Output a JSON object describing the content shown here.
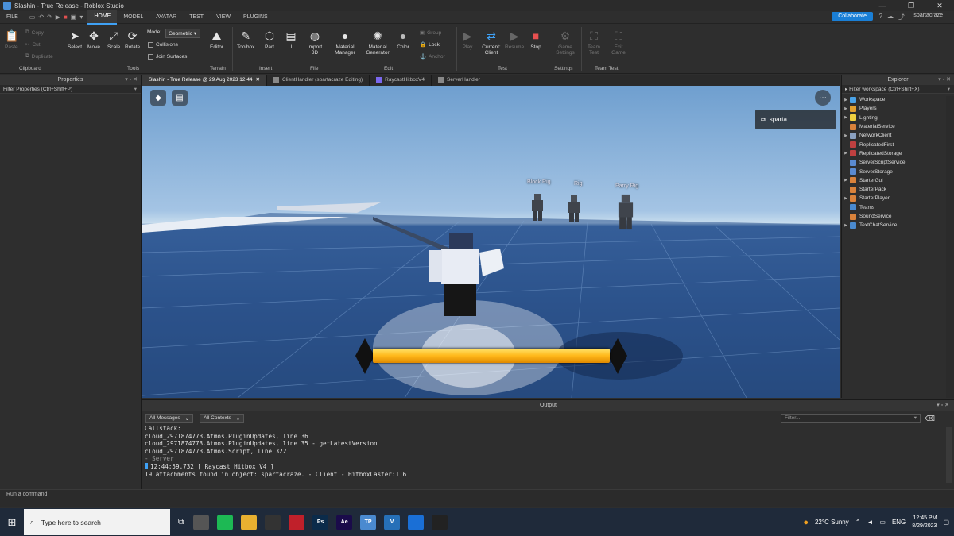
{
  "window": {
    "title": "Slashin - True Release - Roblox Studio",
    "controls": [
      "—",
      "❐",
      "✕"
    ]
  },
  "menu": {
    "items": [
      "FILE",
      "HOME",
      "MODEL",
      "AVATAR",
      "TEST",
      "VIEW",
      "PLUGINS"
    ],
    "active": "HOME",
    "collaborate": "Collaborate",
    "username": "spartacraze"
  },
  "ribbon": {
    "paste": "Paste",
    "copy": "Copy",
    "cut": "Cut",
    "duplicate": "Duplicate",
    "clipboard": "Clipboard",
    "select": "Select",
    "move": "Move",
    "scale": "Scale",
    "rotate": "Rotate",
    "mode_label": "Mode:",
    "mode_value": "Geometric",
    "collisions": "Collisions",
    "join_surfaces": "Join Surfaces",
    "tools": "Tools",
    "editor": "Editor",
    "terrain": "Terrain",
    "toolbox": "Toolbox",
    "part": "Part",
    "ui": "UI",
    "insert": "Insert",
    "import_3d": "Import 3D",
    "file": "File",
    "material_manager": "Material Manager",
    "material_generator": "Material Generator",
    "color": "Color",
    "group": "Group",
    "lock": "Lock",
    "anchor": "Anchor",
    "edit": "Edit",
    "play": "Play",
    "current_client": "Current: Client",
    "resume": "Resume",
    "stop": "Stop",
    "test": "Test",
    "game_settings": "Game Settings",
    "settings": "Settings",
    "team_test": "Team Test",
    "exit_game": "Exit Game",
    "team_test_group": "Team Test"
  },
  "properties": {
    "title": "Properties",
    "filter": "Filter Properties (Ctrl+Shift+P)"
  },
  "tabs": [
    {
      "label": "Slashin - True Release @ 29 Aug 2023 12:44",
      "active": true
    },
    {
      "label": "ClientHandler (spartacraze Editing)",
      "active": false
    },
    {
      "label": "RaycastHitboxV4",
      "active": false
    },
    {
      "label": "ServerHandler",
      "active": false
    }
  ],
  "viewport": {
    "player_name": "sparta",
    "rig_labels": [
      "Block Rig",
      "Rig",
      "Parry Rig"
    ],
    "bar_fill_fraction": 1.0
  },
  "explorer": {
    "title": "Explorer",
    "filter": "Filter workspace (Ctrl+Shift+X)",
    "items": [
      {
        "label": "Workspace",
        "expandable": true,
        "color": "#4aa3e8"
      },
      {
        "label": "Players",
        "expandable": true,
        "color": "#e0a030"
      },
      {
        "label": "Lighting",
        "expandable": true,
        "color": "#f0d040"
      },
      {
        "label": "MaterialService",
        "expandable": false,
        "color": "#d9823b"
      },
      {
        "label": "NetworkClient",
        "expandable": true,
        "color": "#8aa0c0"
      },
      {
        "label": "ReplicatedFirst",
        "expandable": false,
        "color": "#c04040"
      },
      {
        "label": "ReplicatedStorage",
        "expandable": true,
        "color": "#c04040"
      },
      {
        "label": "ServerScriptService",
        "expandable": false,
        "color": "#5a8ad0"
      },
      {
        "label": "ServerStorage",
        "expandable": false,
        "color": "#5a8ad0"
      },
      {
        "label": "StarterGui",
        "expandable": true,
        "color": "#d9823b"
      },
      {
        "label": "StarterPack",
        "expandable": false,
        "color": "#d9823b"
      },
      {
        "label": "StarterPlayer",
        "expandable": true,
        "color": "#d9823b"
      },
      {
        "label": "Teams",
        "expandable": false,
        "color": "#4a8ad0"
      },
      {
        "label": "SoundService",
        "expandable": false,
        "color": "#d9823b"
      },
      {
        "label": "TextChatService",
        "expandable": true,
        "color": "#4a8ad0"
      }
    ]
  },
  "output": {
    "title": "Output",
    "messages_filter": "All Messages",
    "contexts_filter": "All Contexts",
    "filter_placeholder": "Filter...",
    "lines": [
      "Callstack:",
      "cloud_2971874773.Atmos.PluginUpdates, line 36",
      "cloud_2971874773.Atmos.PluginUpdates, line 35 - getLatestVersion",
      "cloud_2971874773.Atmos.Script, line 322"
    ],
    "server_line": " -  Server",
    "timestamp_line": "12:44:59.732  [ Raycast Hitbox V4 ]",
    "last_line": "19 attachments found in object: spartacraze.  -  Client - HitboxCaster:116"
  },
  "command_bar": {
    "placeholder": "Run a command"
  },
  "taskbar": {
    "search": "Type here to search",
    "weather": "22°C  Sunny",
    "lang": "ENG",
    "time": "12:45 PM",
    "date": "8/29/2023",
    "apps": [
      {
        "name": "chrome-icon",
        "label": "",
        "color": "#555"
      },
      {
        "name": "spotify-icon",
        "label": "",
        "color": "#1db954"
      },
      {
        "name": "file-explorer-icon",
        "label": "",
        "color": "#e8b030"
      },
      {
        "name": "obs-icon",
        "label": "",
        "color": "#333"
      },
      {
        "name": "opera-icon",
        "label": "",
        "color": "#c0202a"
      },
      {
        "name": "photoshop-icon",
        "label": "Ps",
        "color": "#0b2b4a"
      },
      {
        "name": "after-effects-icon",
        "label": "Ae",
        "color": "#1a0b4a"
      },
      {
        "name": "tp-icon",
        "label": "TP",
        "color": "#4a8ad0"
      },
      {
        "name": "vscode-icon",
        "label": "V",
        "color": "#2670b8"
      },
      {
        "name": "roblox-studio-icon",
        "label": "",
        "color": "#1a6fd6"
      },
      {
        "name": "steam-icon",
        "label": "",
        "color": "#222"
      }
    ]
  }
}
